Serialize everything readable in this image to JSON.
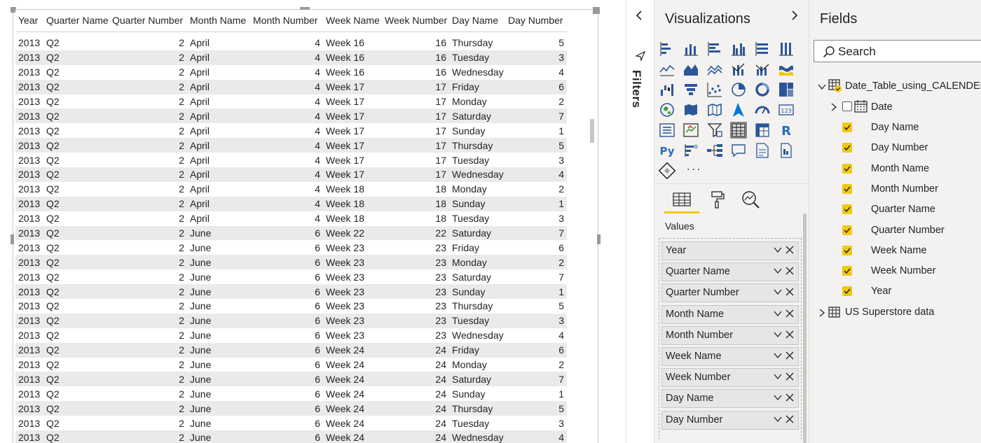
{
  "table": {
    "headers": [
      "Year",
      "Quarter Name",
      "Quarter Number",
      "Month Name",
      "Month Number",
      "Week Name",
      "Week Number",
      "Day Name",
      "Day Number"
    ],
    "cut_row": [
      "",
      "",
      "",
      "",
      "",
      "",
      "",
      "",
      ""
    ],
    "rows": [
      [
        "2013",
        "Q2",
        "2",
        "April",
        "4",
        "Week 16",
        "16",
        "Thursday",
        "5"
      ],
      [
        "2013",
        "Q2",
        "2",
        "April",
        "4",
        "Week 16",
        "16",
        "Tuesday",
        "3"
      ],
      [
        "2013",
        "Q2",
        "2",
        "April",
        "4",
        "Week 16",
        "16",
        "Wednesday",
        "4"
      ],
      [
        "2013",
        "Q2",
        "2",
        "April",
        "4",
        "Week 17",
        "17",
        "Friday",
        "6"
      ],
      [
        "2013",
        "Q2",
        "2",
        "April",
        "4",
        "Week 17",
        "17",
        "Monday",
        "2"
      ],
      [
        "2013",
        "Q2",
        "2",
        "April",
        "4",
        "Week 17",
        "17",
        "Saturday",
        "7"
      ],
      [
        "2013",
        "Q2",
        "2",
        "April",
        "4",
        "Week 17",
        "17",
        "Sunday",
        "1"
      ],
      [
        "2013",
        "Q2",
        "2",
        "April",
        "4",
        "Week 17",
        "17",
        "Thursday",
        "5"
      ],
      [
        "2013",
        "Q2",
        "2",
        "April",
        "4",
        "Week 17",
        "17",
        "Tuesday",
        "3"
      ],
      [
        "2013",
        "Q2",
        "2",
        "April",
        "4",
        "Week 17",
        "17",
        "Wednesday",
        "4"
      ],
      [
        "2013",
        "Q2",
        "2",
        "April",
        "4",
        "Week 18",
        "18",
        "Monday",
        "2"
      ],
      [
        "2013",
        "Q2",
        "2",
        "April",
        "4",
        "Week 18",
        "18",
        "Sunday",
        "1"
      ],
      [
        "2013",
        "Q2",
        "2",
        "April",
        "4",
        "Week 18",
        "18",
        "Tuesday",
        "3"
      ],
      [
        "2013",
        "Q2",
        "2",
        "June",
        "6",
        "Week 22",
        "22",
        "Saturday",
        "7"
      ],
      [
        "2013",
        "Q2",
        "2",
        "June",
        "6",
        "Week 23",
        "23",
        "Friday",
        "6"
      ],
      [
        "2013",
        "Q2",
        "2",
        "June",
        "6",
        "Week 23",
        "23",
        "Monday",
        "2"
      ],
      [
        "2013",
        "Q2",
        "2",
        "June",
        "6",
        "Week 23",
        "23",
        "Saturday",
        "7"
      ],
      [
        "2013",
        "Q2",
        "2",
        "June",
        "6",
        "Week 23",
        "23",
        "Sunday",
        "1"
      ],
      [
        "2013",
        "Q2",
        "2",
        "June",
        "6",
        "Week 23",
        "23",
        "Thursday",
        "5"
      ],
      [
        "2013",
        "Q2",
        "2",
        "June",
        "6",
        "Week 23",
        "23",
        "Tuesday",
        "3"
      ],
      [
        "2013",
        "Q2",
        "2",
        "June",
        "6",
        "Week 23",
        "23",
        "Wednesday",
        "4"
      ],
      [
        "2013",
        "Q2",
        "2",
        "June",
        "6",
        "Week 24",
        "24",
        "Friday",
        "6"
      ],
      [
        "2013",
        "Q2",
        "2",
        "June",
        "6",
        "Week 24",
        "24",
        "Monday",
        "2"
      ],
      [
        "2013",
        "Q2",
        "2",
        "June",
        "6",
        "Week 24",
        "24",
        "Saturday",
        "7"
      ],
      [
        "2013",
        "Q2",
        "2",
        "June",
        "6",
        "Week 24",
        "24",
        "Sunday",
        "1"
      ],
      [
        "2013",
        "Q2",
        "2",
        "June",
        "6",
        "Week 24",
        "24",
        "Thursday",
        "5"
      ],
      [
        "2013",
        "Q2",
        "2",
        "June",
        "6",
        "Week 24",
        "24",
        "Tuesday",
        "3"
      ],
      [
        "2013",
        "Q2",
        "2",
        "June",
        "6",
        "Week 24",
        "24",
        "Wednesday",
        "4"
      ]
    ]
  },
  "filters": {
    "label": "Filters"
  },
  "visualizations": {
    "title": "Visualizations",
    "more": "...",
    "values_label": "Values",
    "wells": [
      "Year",
      "Quarter Name",
      "Quarter Number",
      "Month Name",
      "Month Number",
      "Week Name",
      "Week Number",
      "Day Name",
      "Day Number"
    ],
    "icons": [
      "stacked-bar-chart-icon",
      "stacked-column-chart-icon",
      "clustered-bar-chart-icon",
      "clustered-column-chart-icon",
      "100-stacked-bar-chart-icon",
      "100-stacked-column-chart-icon",
      "line-chart-icon",
      "area-chart-icon",
      "stacked-area-chart-icon",
      "line-and-stacked-column-chart-icon",
      "line-and-clustered-column-chart-icon",
      "ribbon-chart-icon",
      "waterfall-chart-icon",
      "funnel-chart-icon",
      "scatter-chart-icon",
      "pie-chart-icon",
      "donut-chart-icon",
      "treemap-icon",
      "map-icon",
      "filled-map-icon",
      "shape-map-icon",
      "azure-map-icon",
      "gauge-icon",
      "card-icon",
      "multi-row-card-icon",
      "kpi-icon",
      "slicer-icon",
      "table-icon",
      "matrix-icon",
      "r-script-visual-icon",
      "python-visual-icon",
      "key-influencers-icon",
      "decomposition-tree-icon",
      "qa-icon",
      "smart-narrative-icon",
      "paginated-report-icon",
      "power-apps-icon",
      "more-visuals-icon"
    ]
  },
  "fields": {
    "title": "Fields",
    "search_placeholder": "Search",
    "table1": "Date_Table_using_CALENDER",
    "date_field": "Date",
    "items": [
      "Day Name",
      "Day Number",
      "Month Name",
      "Month Number",
      "Quarter Name",
      "Quarter Number",
      "Week Name",
      "Week Number",
      "Year"
    ],
    "table2": "US Superstore data"
  },
  "colors": {
    "accent": "#f2c811",
    "pane_bg": "#f3f2f1",
    "row_band": "#eaeaea",
    "icon_blue": "#2b579a"
  }
}
